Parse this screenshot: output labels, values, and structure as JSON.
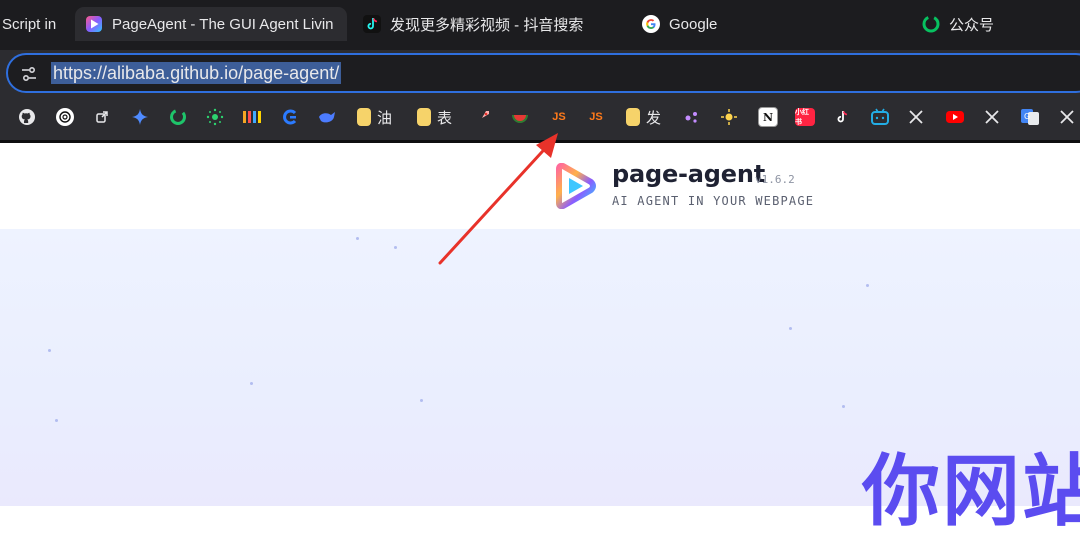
{
  "tabs": [
    {
      "title": "Script in",
      "icon": "script-tab-icon",
      "active": false
    },
    {
      "title": "PageAgent - The GUI Agent Livin",
      "icon": "page-agent-icon",
      "active": true
    },
    {
      "title": "发现更多精彩视频 - 抖音搜索",
      "icon": "douyin-icon",
      "active": false
    },
    {
      "title": "Google",
      "icon": "google-icon",
      "active": false
    },
    {
      "title": "公众号",
      "icon": "wechat-icon",
      "active": false
    }
  ],
  "address_bar": {
    "url": "https://alibaba.github.io/page-agent/",
    "site_settings_icon": "tune-icon",
    "accent": "#2f6fde"
  },
  "bookmarks": {
    "folder_1": "油",
    "folder_2": "表",
    "js_1": "JS",
    "js_2": "JS",
    "folder_3": "发",
    "xiaohongshu": "小红书"
  },
  "page": {
    "brand": "page-agent",
    "version": "v1.6.2",
    "tagline": "AI AGENT IN YOUR WEBPAGE",
    "hero_text": "你网站",
    "accent": "#5b4cf0"
  },
  "annotation": {
    "arrow_color": "#e8322a"
  }
}
